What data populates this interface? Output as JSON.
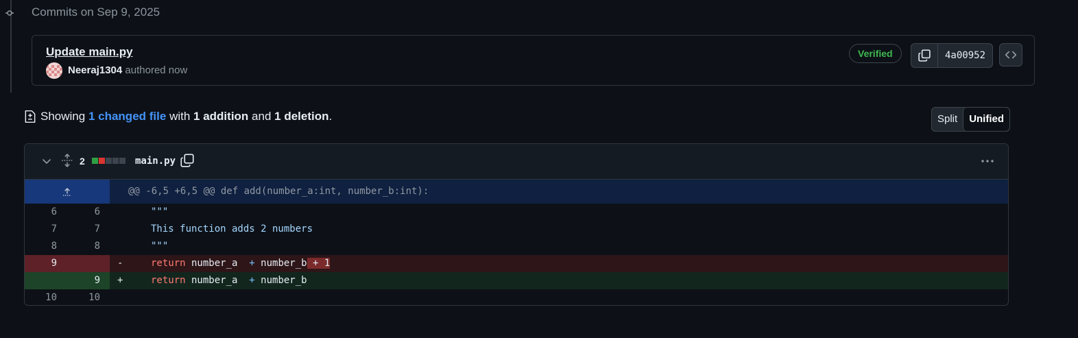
{
  "timeline": {
    "heading": "Commits on Sep 9, 2025"
  },
  "commit": {
    "title": "Update main.py",
    "author": "Neeraj1304",
    "authored_text": "authored now",
    "verified_label": "Verified",
    "sha": "4a00952",
    "icons": [
      "copy-icon",
      "code-icon"
    ]
  },
  "summary": {
    "showing": "Showing",
    "changed_files": "1 changed file",
    "with": "with",
    "additions": "1 addition",
    "and": "and",
    "deletions": "1 deletion",
    "period": "."
  },
  "view_toggle": {
    "split_label": "Split",
    "unified_label": "Unified",
    "selected": "Unified"
  },
  "diff_file": {
    "change_count": "2",
    "file_name": "main.py",
    "diffstat": [
      "added",
      "deleted",
      "neutral",
      "neutral",
      "neutral"
    ],
    "hunk_header": "@@ -6,5 +6,5 @@ def add(number_a:int, number_b:int):",
    "lines": [
      {
        "old": "6",
        "new": "6",
        "type": "context",
        "marker": "",
        "code": "\"\"\""
      },
      {
        "old": "7",
        "new": "7",
        "type": "context",
        "marker": "",
        "code": "This function adds 2 numbers"
      },
      {
        "old": "8",
        "new": "8",
        "type": "context",
        "marker": "",
        "code": "\"\"\""
      },
      {
        "old": "9",
        "new": "",
        "type": "deletion",
        "marker": "-",
        "code_kw": "return",
        "code_a": " number_a  ",
        "code_op": "+",
        "code_b": " number_b",
        "code_hl": " + 1"
      },
      {
        "old": "",
        "new": "9",
        "type": "addition",
        "marker": "+",
        "code_kw": "return",
        "code_a": " number_a  ",
        "code_op": "+",
        "code_b": " number_b"
      },
      {
        "old": "10",
        "new": "10",
        "type": "context",
        "marker": "",
        "code": ""
      }
    ]
  },
  "colors": {
    "background": "#0d1117",
    "verified": "#3fb950",
    "link": "#4493f8",
    "addition": "#1d4428",
    "deletion": "#5e2127"
  }
}
